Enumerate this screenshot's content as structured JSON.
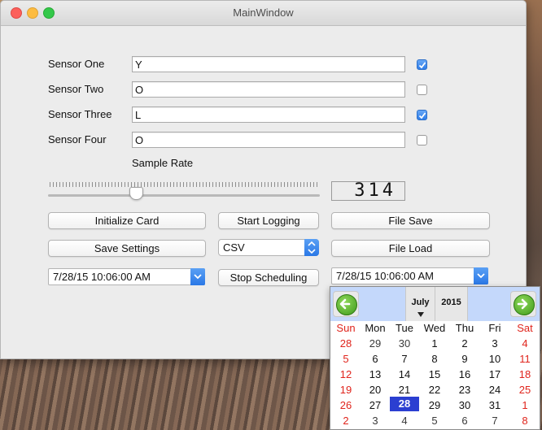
{
  "window": {
    "title": "MainWindow"
  },
  "sensors": [
    {
      "label": "Sensor One",
      "value": "Y",
      "checked": true
    },
    {
      "label": "Sensor Two",
      "value": "O",
      "checked": false
    },
    {
      "label": "Sensor Three",
      "value": "L",
      "checked": true
    },
    {
      "label": "Sensor Four",
      "value": "O",
      "checked": false
    }
  ],
  "sample_rate": {
    "label": "Sample Rate",
    "lcd_value": "314"
  },
  "buttons": {
    "initialize_card": "Initialize Card",
    "start_logging": "Start Logging",
    "file_save": "File Save",
    "save_settings": "Save Settings",
    "file_load": "File Load",
    "stop_scheduling": "Stop Scheduling"
  },
  "format_select": {
    "value": "CSV"
  },
  "datetime_left": {
    "value": "7/28/15 10:06:00 AM"
  },
  "datetime_right": {
    "value": "7/28/15 10:06:00 AM"
  },
  "calendar": {
    "month": "July",
    "year": "2015",
    "weekdays": [
      "Sun",
      "Mon",
      "Tue",
      "Wed",
      "Thu",
      "Fri",
      "Sat"
    ],
    "weeks": [
      [
        "28",
        "29",
        "30",
        "1",
        "2",
        "3",
        "4"
      ],
      [
        "5",
        "6",
        "7",
        "8",
        "9",
        "10",
        "11"
      ],
      [
        "12",
        "13",
        "14",
        "15",
        "16",
        "17",
        "18"
      ],
      [
        "19",
        "20",
        "21",
        "22",
        "23",
        "24",
        "25"
      ],
      [
        "26",
        "27",
        "28",
        "29",
        "30",
        "31",
        "1"
      ],
      [
        "2",
        "3",
        "4",
        "5",
        "6",
        "7",
        "8"
      ]
    ],
    "selected_day": "28"
  }
}
